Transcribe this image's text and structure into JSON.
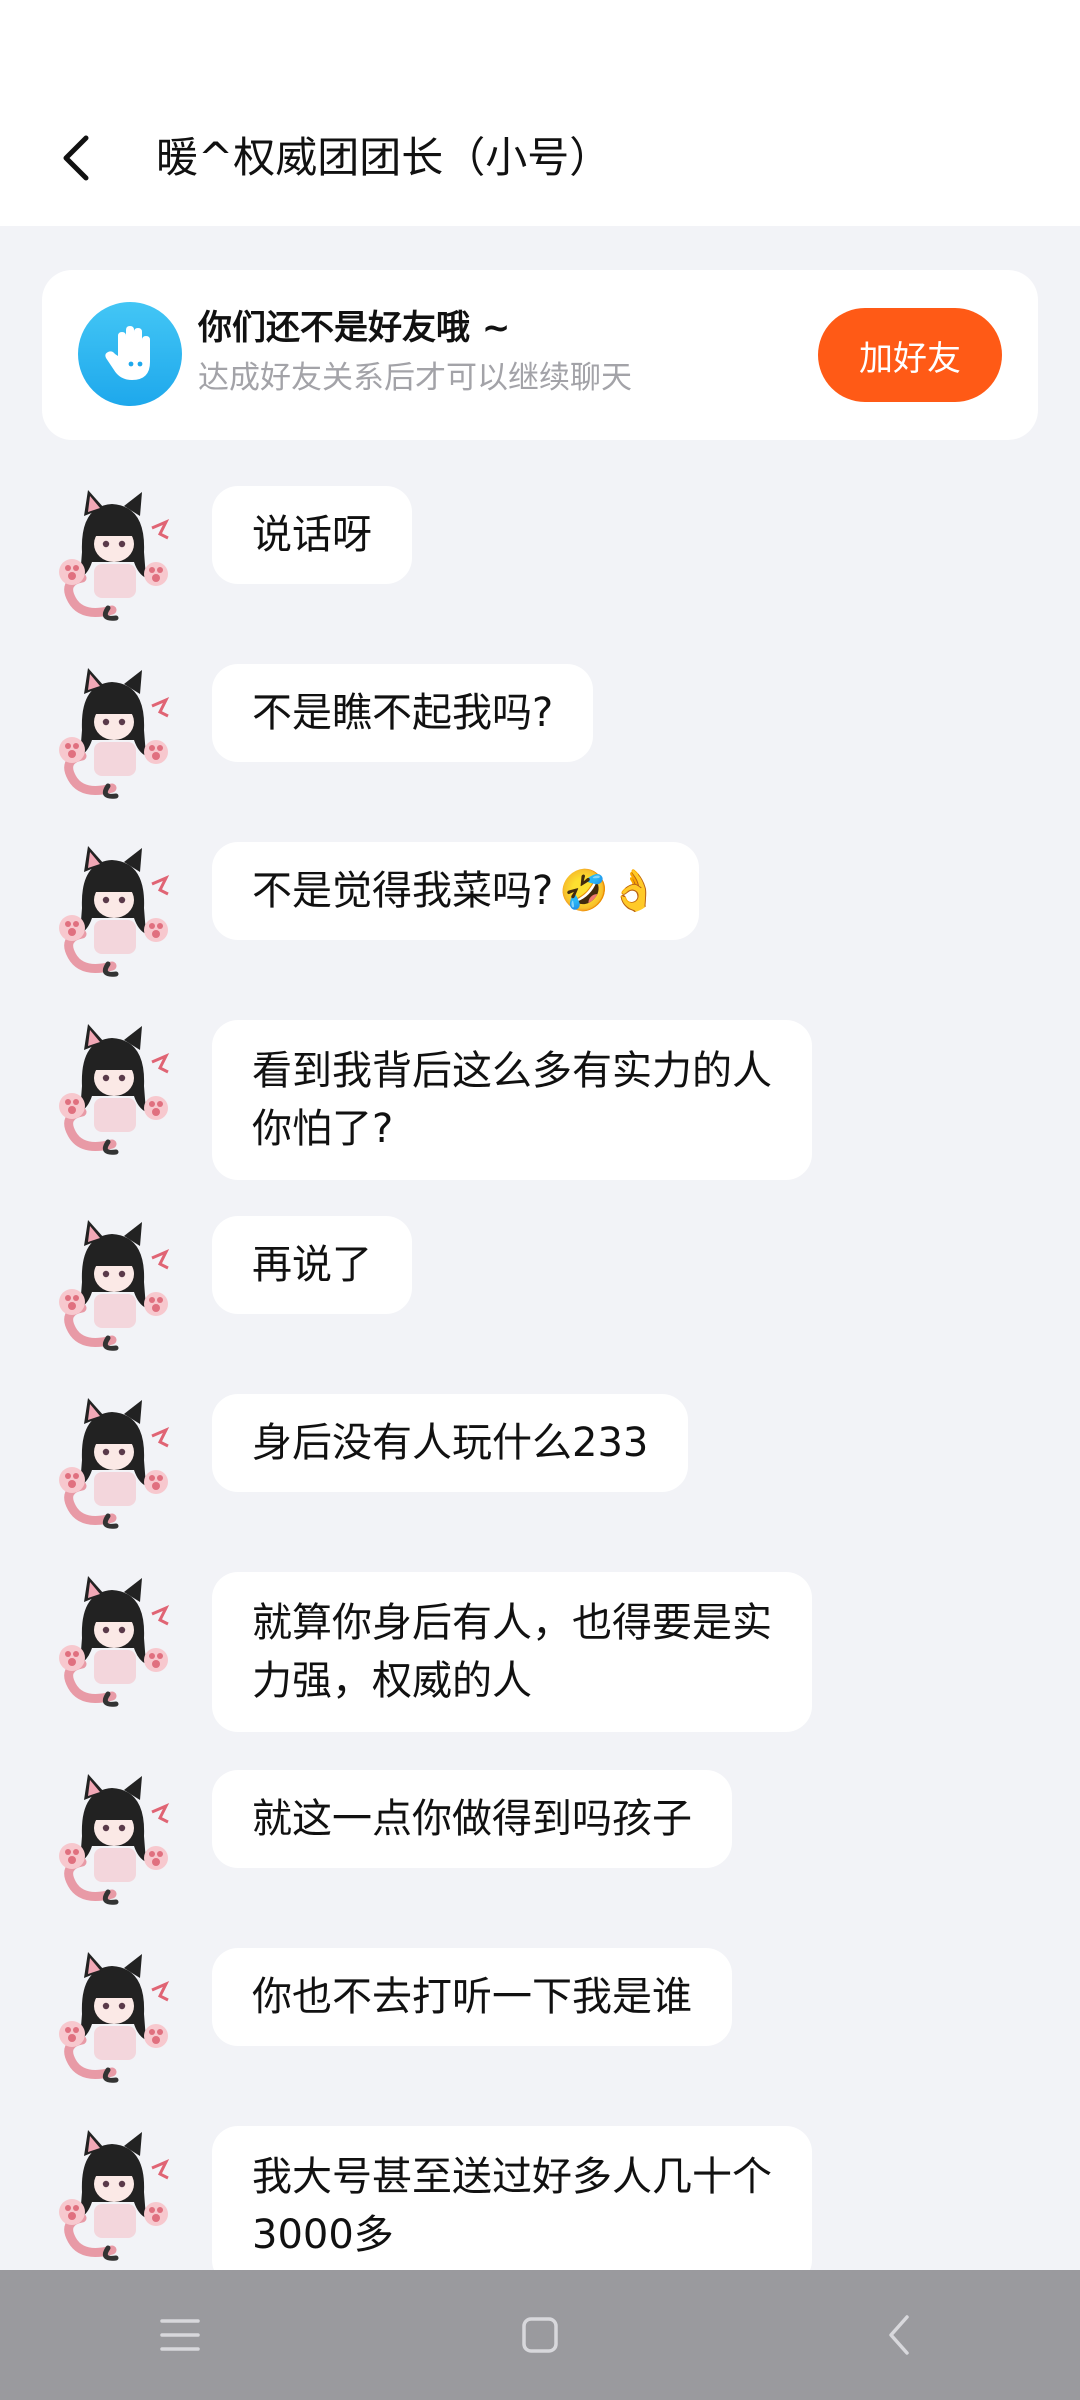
{
  "header": {
    "title": "暖^权威团团长（小号）"
  },
  "friend_card": {
    "title": "你们还不是好友哦 ~",
    "subtitle": "达成好友关系后才可以继续聊天",
    "button_label": "加好友"
  },
  "messages": [
    {
      "text": "说话呀",
      "emoji": ""
    },
    {
      "text": "不是瞧不起我吗?",
      "emoji": ""
    },
    {
      "text": "不是觉得我菜吗?",
      "emoji": "🤣👌"
    },
    {
      "text": "看到我背后这么多有实力的人\n你怕了?",
      "emoji": ""
    },
    {
      "text": "再说了",
      "emoji": ""
    },
    {
      "text": "身后没有人玩什么233",
      "emoji": ""
    },
    {
      "text": "就算你身后有人，也得要是实\n力强，权威的人",
      "emoji": ""
    },
    {
      "text": "就这一点你做得到吗孩子",
      "emoji": ""
    },
    {
      "text": "你也不去打听一下我是谁",
      "emoji": ""
    },
    {
      "text": "我大号甚至送过好多人几十个\n3000多",
      "emoji": ""
    }
  ],
  "nav": {
    "icons": [
      "menu-icon",
      "home-icon",
      "back-icon"
    ]
  },
  "colors": {
    "accent": "#ff5a16",
    "background": "#f2f3f7",
    "bubble": "#ffffff",
    "hand_icon": "#2aaef0"
  }
}
